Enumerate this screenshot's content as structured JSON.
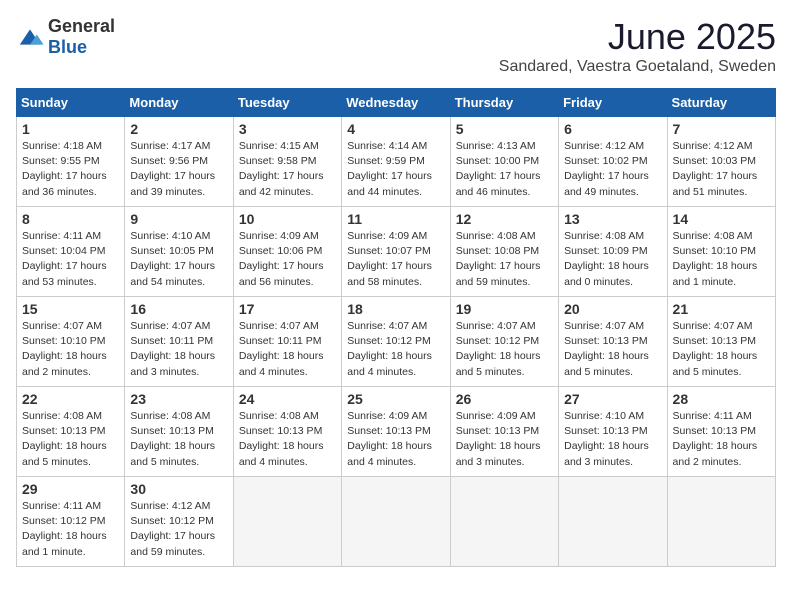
{
  "logo": {
    "general": "General",
    "blue": "Blue"
  },
  "title": "June 2025",
  "location": "Sandared, Vaestra Goetaland, Sweden",
  "weekdays": [
    "Sunday",
    "Monday",
    "Tuesday",
    "Wednesday",
    "Thursday",
    "Friday",
    "Saturday"
  ],
  "weeks": [
    [
      {
        "day": "1",
        "sunrise": "4:18 AM",
        "sunset": "9:55 PM",
        "daylight": "17 hours and 36 minutes."
      },
      {
        "day": "2",
        "sunrise": "4:17 AM",
        "sunset": "9:56 PM",
        "daylight": "17 hours and 39 minutes."
      },
      {
        "day": "3",
        "sunrise": "4:15 AM",
        "sunset": "9:58 PM",
        "daylight": "17 hours and 42 minutes."
      },
      {
        "day": "4",
        "sunrise": "4:14 AM",
        "sunset": "9:59 PM",
        "daylight": "17 hours and 44 minutes."
      },
      {
        "day": "5",
        "sunrise": "4:13 AM",
        "sunset": "10:00 PM",
        "daylight": "17 hours and 46 minutes."
      },
      {
        "day": "6",
        "sunrise": "4:12 AM",
        "sunset": "10:02 PM",
        "daylight": "17 hours and 49 minutes."
      },
      {
        "day": "7",
        "sunrise": "4:12 AM",
        "sunset": "10:03 PM",
        "daylight": "17 hours and 51 minutes."
      }
    ],
    [
      {
        "day": "8",
        "sunrise": "4:11 AM",
        "sunset": "10:04 PM",
        "daylight": "17 hours and 53 minutes."
      },
      {
        "day": "9",
        "sunrise": "4:10 AM",
        "sunset": "10:05 PM",
        "daylight": "17 hours and 54 minutes."
      },
      {
        "day": "10",
        "sunrise": "4:09 AM",
        "sunset": "10:06 PM",
        "daylight": "17 hours and 56 minutes."
      },
      {
        "day": "11",
        "sunrise": "4:09 AM",
        "sunset": "10:07 PM",
        "daylight": "17 hours and 58 minutes."
      },
      {
        "day": "12",
        "sunrise": "4:08 AM",
        "sunset": "10:08 PM",
        "daylight": "17 hours and 59 minutes."
      },
      {
        "day": "13",
        "sunrise": "4:08 AM",
        "sunset": "10:09 PM",
        "daylight": "18 hours and 0 minutes."
      },
      {
        "day": "14",
        "sunrise": "4:08 AM",
        "sunset": "10:10 PM",
        "daylight": "18 hours and 1 minute."
      }
    ],
    [
      {
        "day": "15",
        "sunrise": "4:07 AM",
        "sunset": "10:10 PM",
        "daylight": "18 hours and 2 minutes."
      },
      {
        "day": "16",
        "sunrise": "4:07 AM",
        "sunset": "10:11 PM",
        "daylight": "18 hours and 3 minutes."
      },
      {
        "day": "17",
        "sunrise": "4:07 AM",
        "sunset": "10:11 PM",
        "daylight": "18 hours and 4 minutes."
      },
      {
        "day": "18",
        "sunrise": "4:07 AM",
        "sunset": "10:12 PM",
        "daylight": "18 hours and 4 minutes."
      },
      {
        "day": "19",
        "sunrise": "4:07 AM",
        "sunset": "10:12 PM",
        "daylight": "18 hours and 5 minutes."
      },
      {
        "day": "20",
        "sunrise": "4:07 AM",
        "sunset": "10:13 PM",
        "daylight": "18 hours and 5 minutes."
      },
      {
        "day": "21",
        "sunrise": "4:07 AM",
        "sunset": "10:13 PM",
        "daylight": "18 hours and 5 minutes."
      }
    ],
    [
      {
        "day": "22",
        "sunrise": "4:08 AM",
        "sunset": "10:13 PM",
        "daylight": "18 hours and 5 minutes."
      },
      {
        "day": "23",
        "sunrise": "4:08 AM",
        "sunset": "10:13 PM",
        "daylight": "18 hours and 5 minutes."
      },
      {
        "day": "24",
        "sunrise": "4:08 AM",
        "sunset": "10:13 PM",
        "daylight": "18 hours and 4 minutes."
      },
      {
        "day": "25",
        "sunrise": "4:09 AM",
        "sunset": "10:13 PM",
        "daylight": "18 hours and 4 minutes."
      },
      {
        "day": "26",
        "sunrise": "4:09 AM",
        "sunset": "10:13 PM",
        "daylight": "18 hours and 3 minutes."
      },
      {
        "day": "27",
        "sunrise": "4:10 AM",
        "sunset": "10:13 PM",
        "daylight": "18 hours and 3 minutes."
      },
      {
        "day": "28",
        "sunrise": "4:11 AM",
        "sunset": "10:13 PM",
        "daylight": "18 hours and 2 minutes."
      }
    ],
    [
      {
        "day": "29",
        "sunrise": "4:11 AM",
        "sunset": "10:12 PM",
        "daylight": "18 hours and 1 minute."
      },
      {
        "day": "30",
        "sunrise": "4:12 AM",
        "sunset": "10:12 PM",
        "daylight": "17 hours and 59 minutes."
      },
      null,
      null,
      null,
      null,
      null
    ]
  ]
}
